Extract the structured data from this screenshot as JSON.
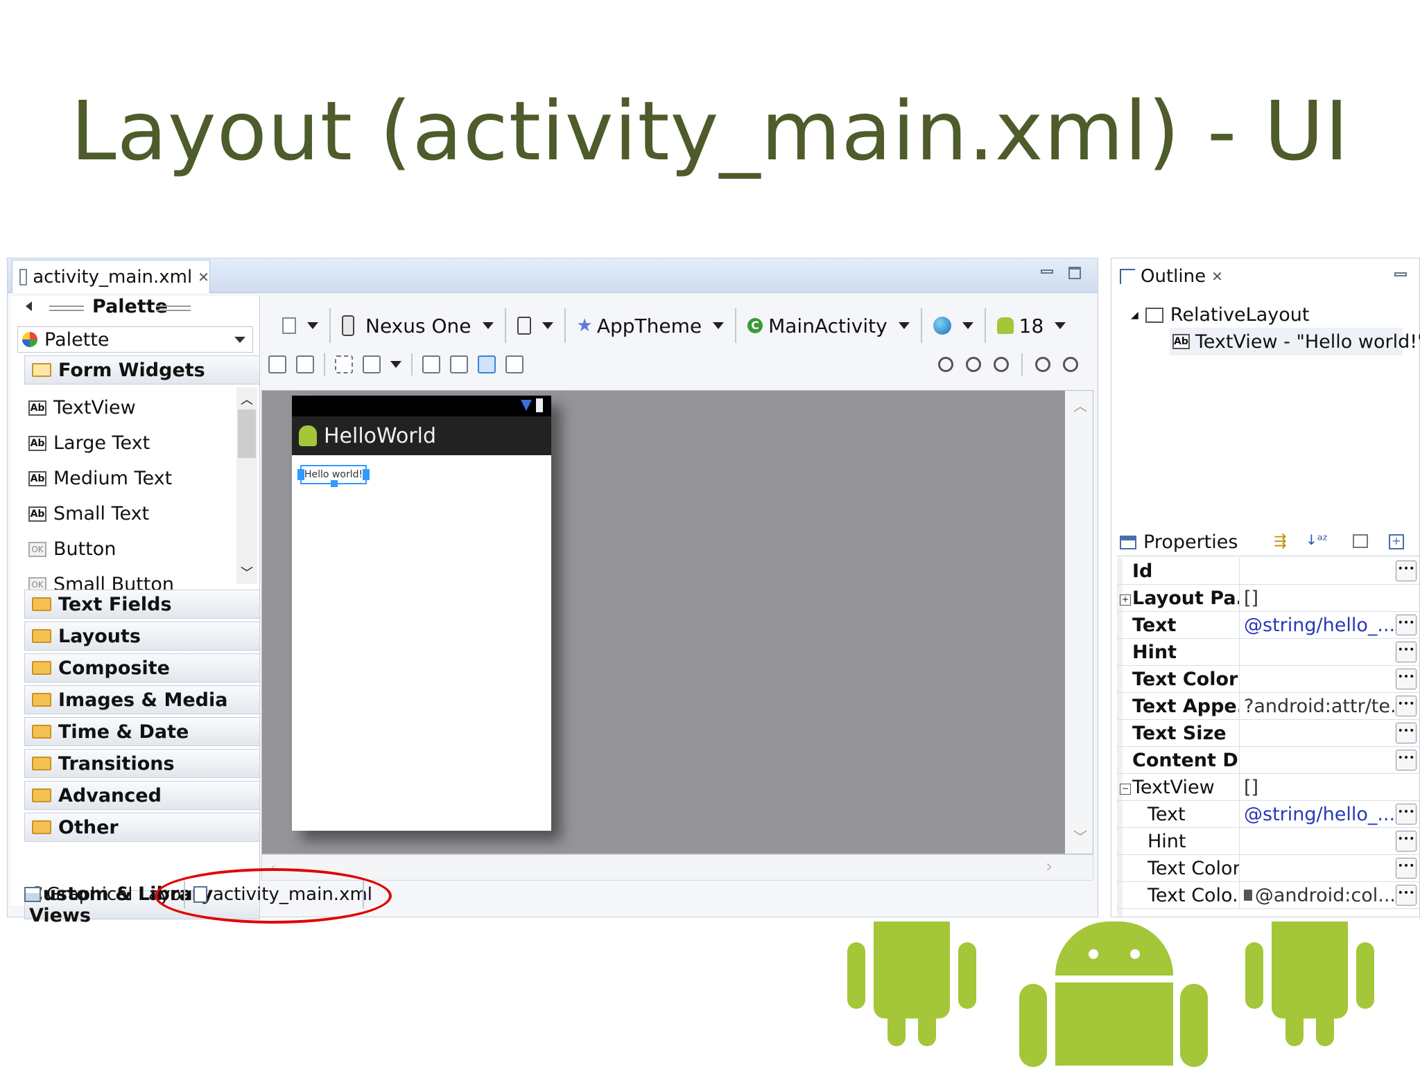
{
  "slide": {
    "title": "Layout (activity_main.xml) - UI"
  },
  "editor": {
    "file_tab": "activity_main.xml",
    "palette_header": "Palette",
    "palette_dropdown": "Palette",
    "form_widgets": {
      "label": "Form Widgets",
      "items": [
        {
          "label": "TextView",
          "icon": "ab"
        },
        {
          "label": "Large Text",
          "icon": "ab"
        },
        {
          "label": "Medium Text",
          "icon": "ab"
        },
        {
          "label": "Small Text",
          "icon": "ab"
        },
        {
          "label": "Button",
          "icon": "ok"
        },
        {
          "label": "Small Button",
          "icon": "ok"
        }
      ]
    },
    "categories": [
      "Text Fields",
      "Layouts",
      "Composite",
      "Images & Media",
      "Time & Date",
      "Transitions",
      "Advanced",
      "Other"
    ],
    "custom_views": "Custom & Library Views",
    "toolbar": {
      "device": "Nexus One",
      "theme": "AppTheme",
      "activity": "MainActivity",
      "api_level": "18"
    },
    "device_preview": {
      "app_title": "HelloWorld",
      "text_view": "Hello world!"
    },
    "bottom_tabs": {
      "graphical": "Graphical Layout",
      "xml": "activity_main.xml"
    },
    "accent_color": "#3399ff",
    "highlight_color": "#e00000"
  },
  "outline": {
    "title": "Outline",
    "tree": {
      "root": "RelativeLayout",
      "child": "TextView - \"Hello world!\""
    }
  },
  "properties": {
    "title": "Properties",
    "rows": [
      {
        "name": "Id",
        "value": "",
        "bold": true,
        "btn": true,
        "indent": 0,
        "expander": ""
      },
      {
        "name": "Layout Pa...",
        "value": "[]",
        "bold": true,
        "btn": false,
        "indent": 0,
        "expander": "+"
      },
      {
        "name": "Text",
        "value": "@string/hello_...",
        "bold": true,
        "btn": true,
        "indent": 0,
        "expander": "",
        "blue": true
      },
      {
        "name": "Hint",
        "value": "",
        "bold": true,
        "btn": true,
        "indent": 0,
        "expander": ""
      },
      {
        "name": "Text Color",
        "value": "",
        "bold": true,
        "btn": true,
        "indent": 0,
        "expander": ""
      },
      {
        "name": "Text Appe...",
        "value": "?android:attr/te...",
        "bold": true,
        "btn": true,
        "indent": 0,
        "expander": ""
      },
      {
        "name": "Text Size",
        "value": "",
        "bold": true,
        "btn": true,
        "indent": 0,
        "expander": ""
      },
      {
        "name": "Content D...",
        "value": "",
        "bold": true,
        "btn": true,
        "indent": 0,
        "expander": ""
      },
      {
        "name": "TextView",
        "value": "[]",
        "bold": false,
        "btn": false,
        "indent": 0,
        "expander": "-"
      },
      {
        "name": "Text",
        "value": "@string/hello_...",
        "bold": false,
        "btn": true,
        "indent": 1,
        "expander": "",
        "blue": true
      },
      {
        "name": "Hint",
        "value": "",
        "bold": false,
        "btn": true,
        "indent": 1,
        "expander": ""
      },
      {
        "name": "Text Color",
        "value": "",
        "bold": false,
        "btn": true,
        "indent": 1,
        "expander": ""
      },
      {
        "name": "Text Colo...",
        "value": "@android:col...",
        "bold": false,
        "btn": true,
        "indent": 1,
        "expander": "",
        "swatch": true
      }
    ]
  }
}
